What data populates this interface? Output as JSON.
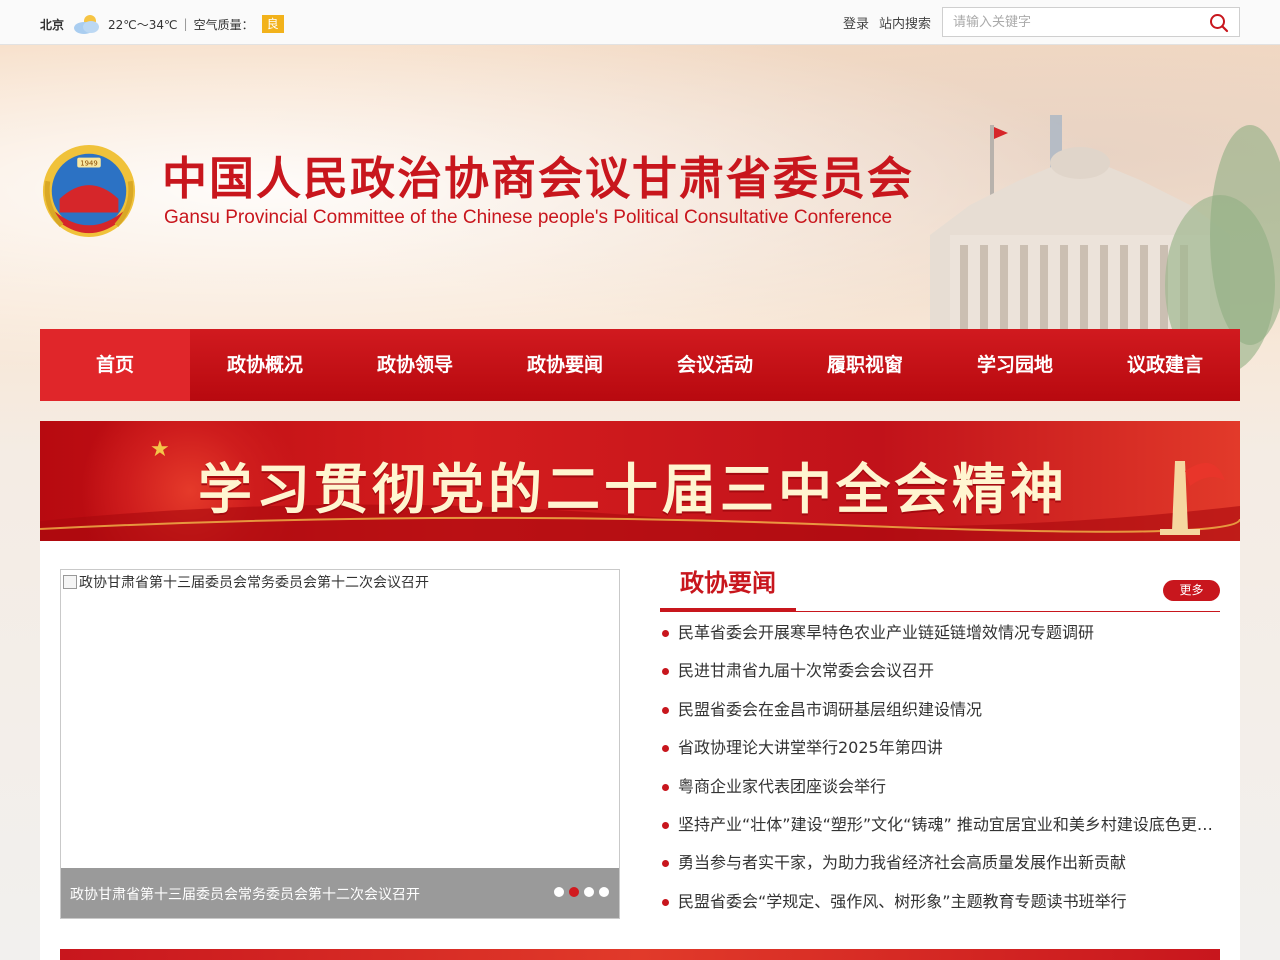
{
  "topbar": {
    "city": "北京",
    "weather_icon": "partly-cloudy-icon",
    "temperature": "22℃～34℃",
    "separator": "|",
    "aqi_label": "空气质量：",
    "aqi_value": "良",
    "login": "登录",
    "site_search": "站内搜索",
    "search_placeholder": "请输入关键字"
  },
  "header": {
    "title": "中国人民政治协商会议甘肃省委员会",
    "subtitle": "Gansu Provincial Committee of the Chinese people's Political Consultative Conference",
    "emblem_text": "1949"
  },
  "nav": {
    "items": [
      {
        "label": "首页",
        "active": true
      },
      {
        "label": "政协概况"
      },
      {
        "label": "政协领导"
      },
      {
        "label": "政协要闻"
      },
      {
        "label": "会议活动"
      },
      {
        "label": "履职视窗"
      },
      {
        "label": "学习园地"
      },
      {
        "label": "议政建言"
      }
    ]
  },
  "promo": {
    "text": "学习贯彻党的二十届三中全会精神"
  },
  "slider": {
    "image_alt": "政协甘肃省第十三届委员会常务委员会第十二次会议召开",
    "caption": "政协甘肃省第十三届委员会常务委员会第十二次会议召开",
    "dot_count": 4,
    "active_dot": 2
  },
  "news": {
    "title": "政协要闻",
    "more": "更多",
    "items": [
      "民革省委会开展寒旱特色农业产业链延链增效情况专题调研",
      "民进甘肃省九届十次常委会会议召开",
      "民盟省委会在金昌市调研基层组织建设情况",
      "省政协理论大讲堂举行2025年第四讲",
      "粤商企业家代表团座谈会举行",
      "坚持产业“壮体”建设“塑形”文化“铸魂”  推动宜居宜业和美乡村建设底色更亮成色更足",
      "勇当参与者实干家，为助力我省经济社会高质量发展作出新贡献",
      "民盟省委会“学规定、强作风、树形象”主题教育专题读书班举行"
    ]
  },
  "colors": {
    "brand_red": "#c8161d",
    "nav_active": "#e0262a",
    "aqi_badge": "#f2b21b"
  }
}
